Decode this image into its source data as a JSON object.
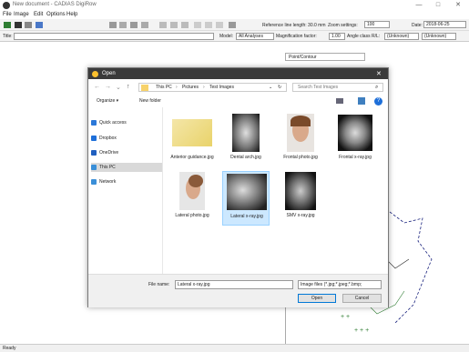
{
  "app": {
    "title": "New document - CADIAS DigiRow",
    "window_controls": {
      "minimize": "—",
      "maximize": "□",
      "close": "✕"
    }
  },
  "menu": [
    "File",
    "Image",
    "Edit",
    "Options",
    "Help"
  ],
  "toolbar": {
    "ref_line_label": "Reference line length: 30.0 mm",
    "zoom_label": "Zoom settings:",
    "zoom_value": "100",
    "date_label": "Date:",
    "date_value": "2018-06-25"
  },
  "toolbar2": {
    "title_label": "Title:",
    "title_value": "",
    "model_label": "Model:",
    "model_value": "All Analyses",
    "magnification_label": "Magnification factor:",
    "magnification_value": "1.00",
    "angle_label": "Angle class R/L:",
    "angle_left": "(Unknown)",
    "angle_right": "(Unknown)"
  },
  "canvas": {
    "dropdown_label": "Point/Contour"
  },
  "status": {
    "text": "Ready"
  },
  "dialog": {
    "title": "Open",
    "close": "✕",
    "path": [
      "This PC",
      "Pictures",
      "Test Images"
    ],
    "search_placeholder": "Search Test Images",
    "organize": "Organize ▾",
    "new_folder": "New folder",
    "nav_items": [
      {
        "label": "Quick access",
        "color": "#2b78d8"
      },
      {
        "label": "Dropbox",
        "color": "#1e6fd9"
      },
      {
        "label": "OneDrive",
        "color": "#1f5fbf"
      },
      {
        "label": "This PC",
        "color": "#3a8fd8"
      },
      {
        "label": "Network",
        "color": "#3a8fd8"
      }
    ],
    "files": [
      {
        "name": "Anterior guidance.jpg"
      },
      {
        "name": "Dental arch.jpg"
      },
      {
        "name": "Frontal photo.jpg"
      },
      {
        "name": "Frontal x-ray.jpg"
      },
      {
        "name": "Lateral photo.jpg"
      },
      {
        "name": "Lateral x-ray.jpg"
      },
      {
        "name": "SMV x-ray.jpg"
      }
    ],
    "filename_label": "File name:",
    "filename_value": "Lateral x-ray.jpg",
    "filetype_value": "Image files (*.jpg;*.jpeg;*.bmp;",
    "open_button": "Open",
    "cancel_button": "Cancel"
  }
}
